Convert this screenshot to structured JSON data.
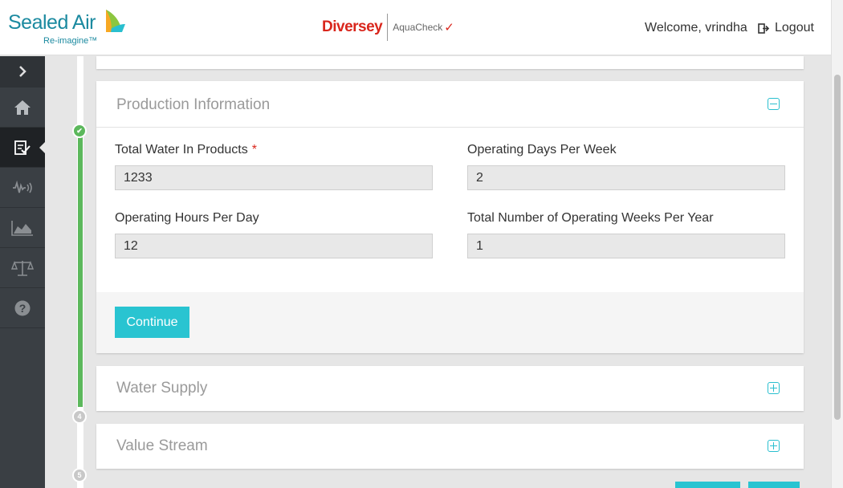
{
  "header": {
    "brand_primary": "Sealed Air",
    "brand_primary_tagline": "Re-imagine™",
    "brand_secondary": "Diversey",
    "product_name": "AquaCheck",
    "welcome_text": "Welcome, vrindha",
    "logout_label": "Logout"
  },
  "sidebar": {
    "items": [
      {
        "icon": "chevron-right-icon"
      },
      {
        "icon": "home-icon"
      },
      {
        "icon": "checklist-icon",
        "active": true
      },
      {
        "icon": "waveform-icon"
      },
      {
        "icon": "area-chart-icon"
      },
      {
        "icon": "scale-icon"
      },
      {
        "icon": "help-icon"
      }
    ]
  },
  "timeline": {
    "steps": [
      "4",
      "5"
    ]
  },
  "sections": {
    "production": {
      "title": "Production Information",
      "fields": {
        "total_water": {
          "label": "Total Water In Products",
          "required_mark": "*",
          "value": "1233"
        },
        "operating_days": {
          "label": "Operating Days Per Week",
          "value": "2"
        },
        "operating_hours": {
          "label": "Operating Hours Per Day",
          "value": "12"
        },
        "operating_weeks": {
          "label": "Total Number of Operating Weeks Per Year",
          "value": "1"
        }
      },
      "continue_label": "Continue"
    },
    "water_supply": {
      "title": "Water Supply"
    },
    "value_stream": {
      "title": "Value Stream"
    }
  },
  "colors": {
    "accent": "#29c4d1",
    "success": "#5cb85c",
    "brand_red": "#d9261c",
    "brand_teal": "#1b8aa0",
    "sidebar_bg": "#3a3f44"
  }
}
